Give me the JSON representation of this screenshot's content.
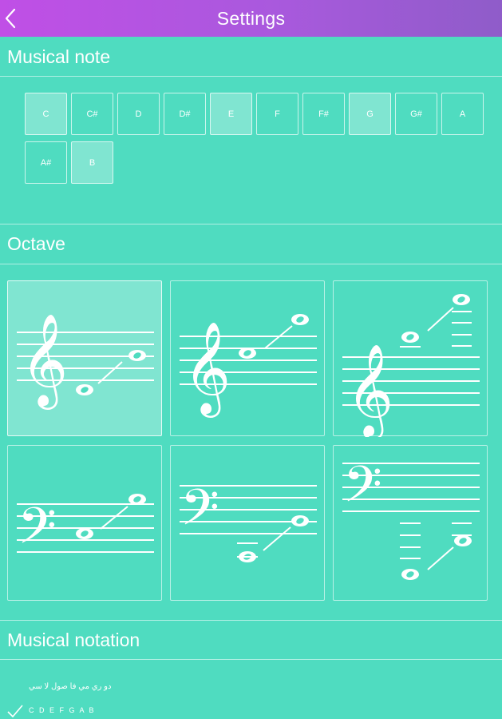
{
  "header": {
    "title": "Settings",
    "back_icon": "chevron-left-icon"
  },
  "sections": {
    "musical_note": {
      "title": "Musical note"
    },
    "octave": {
      "title": "Octave"
    },
    "musical_notation": {
      "title": "Musical notation"
    }
  },
  "notes": [
    {
      "label": "C",
      "selected": true
    },
    {
      "label": "C#",
      "selected": false
    },
    {
      "label": "D",
      "selected": false
    },
    {
      "label": "D#",
      "selected": false
    },
    {
      "label": "E",
      "selected": true
    },
    {
      "label": "F",
      "selected": false
    },
    {
      "label": "F#",
      "selected": false
    },
    {
      "label": "G",
      "selected": true
    },
    {
      "label": "G#",
      "selected": false
    },
    {
      "label": "A",
      "selected": false
    },
    {
      "label": "A#",
      "selected": false
    },
    {
      "label": "B",
      "selected": true
    }
  ],
  "octave_options": [
    {
      "clef": "treble-clef-icon",
      "selected": true
    },
    {
      "clef": "treble-clef-icon",
      "selected": false
    },
    {
      "clef": "treble-clef-icon",
      "selected": false
    },
    {
      "clef": "bass-clef-icon",
      "selected": false
    },
    {
      "clef": "bass-clef-icon",
      "selected": false
    },
    {
      "clef": "bass-clef-icon",
      "selected": false
    }
  ],
  "notation_options": [
    {
      "label": "دو ري مي فا صول لا سي",
      "checked": false
    },
    {
      "label": "C D E F G A B",
      "checked": true
    }
  ],
  "colors": {
    "background": "#4fdcc0",
    "header_gradient_start": "#c04fe6",
    "header_gradient_end": "#8f5cc9",
    "foreground": "#ffffff"
  }
}
